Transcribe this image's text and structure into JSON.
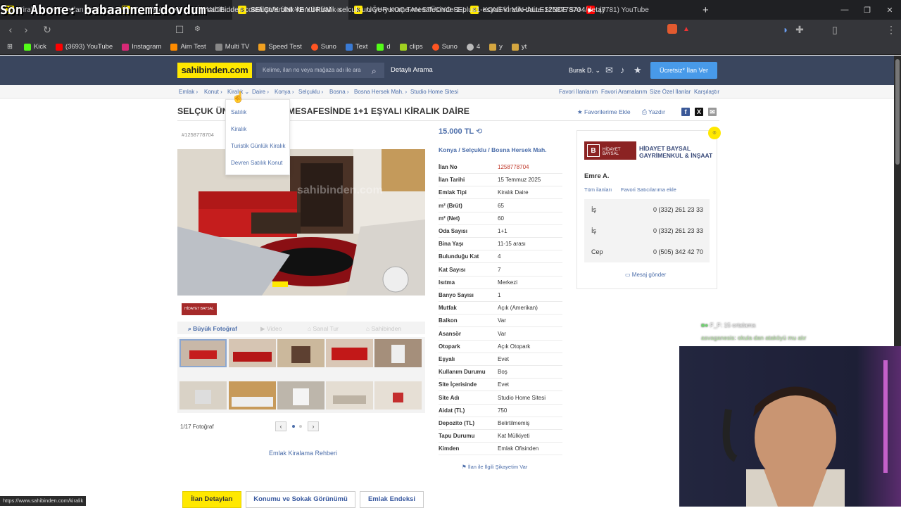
{
  "overlay_text": "Son Abone: babaannemidovdum",
  "browser": {
    "tabs": [
      {
        "label": "Kiralık Daire Fiyatları ve Kiralık Ev İlanları",
        "fav": "S",
        "favclass": "fav-s"
      },
      {
        "label": "TOLUHAN 3+1 REZİDANCE da HE",
        "fav": "S",
        "favclass": "fav-s"
      },
      {
        "label": "SELÇUK ÜNİ YE YÜRÜME MESAF",
        "fav": "S",
        "favclass": "fav-s"
      },
      {
        "label": "UĞUR KOÇ TAN STÜDYO SELÇUKTA",
        "fav": "S",
        "favclass": "fav-s"
      },
      {
        "label": "KONEVİ MAHALLESİ'NDE SAHİBİNDE",
        "fav": "S",
        "favclass": "fav-s"
      },
      {
        "label": "(7781) YouTube",
        "fav": "▶",
        "favclass": "fav-y"
      }
    ],
    "url": "sahibinden.com/ilan/emlak-konut-kiralik-selcuk-uni-ye-yurume-mesafesinde-1-plus1-esyali-kiralik-daire-1258778704/detay",
    "bookmarks": [
      {
        "label": "Kick",
        "color": "#53fc18"
      },
      {
        "label": "(3693) YouTube",
        "color": "#ff0000"
      },
      {
        "label": "Instagram",
        "color": "#d62976"
      },
      {
        "label": "Aim Test",
        "color": "#ff8c00"
      },
      {
        "label": "Multi TV",
        "color": "#888"
      },
      {
        "label": "Speed Test",
        "color": "#f0a020"
      },
      {
        "label": "Suno",
        "color": "#ff5522"
      },
      {
        "label": "Text",
        "color": "#3a7bd5"
      },
      {
        "label": "d",
        "color": "#53fc18"
      },
      {
        "label": "clips",
        "color": "#a0d020"
      },
      {
        "label": "Suno",
        "color": "#ff5522"
      },
      {
        "label": "4",
        "color": "#bbb"
      },
      {
        "label": "y",
        "color": "#d4a640"
      },
      {
        "label": "yt",
        "color": "#d4a640"
      }
    ],
    "status_url": "https://www.sahibinden.com/kiralik"
  },
  "header": {
    "logo": "sahibinden.com",
    "search_placeholder": "Kelime, ilan no veya mağaza adı ile ara",
    "advanced_search": "Detaylı Arama",
    "user": "Burak D.",
    "cta": "Ücretsiz* İlan Ver"
  },
  "breadcrumb": [
    "Emlak",
    "Konut",
    "Kiralık",
    "Daire",
    "Konya",
    "Selçuklu",
    "Bosna",
    "Bosna Hersek Mah.",
    "Studio Home Sitesi"
  ],
  "right_links": [
    "Favori İlanlarım",
    "Favori Aramalarım",
    "Size Özel İlanlar",
    "Karşılaştır"
  ],
  "dropdown": [
    "Satılık",
    "Kiralık",
    "Turistik Günlük Kiralık",
    "Devren Satılık Konut"
  ],
  "listing": {
    "title": "SELÇUK ÜNİ YE YÜRÜME MESAFESİNDE 1+1 EŞYALI KİRALIK DAİRE",
    "add_favorite": "Favorilerime Ekle",
    "print": "Yazdır",
    "listing_id": "#1258778704",
    "price": "15.000 TL",
    "location": [
      "Konya",
      "Selçuklu",
      "Bosna Hersek Mah."
    ],
    "photo_watermark": "sahibinden.com",
    "photo_tabs": [
      "Büyük Fotoğraf",
      "Video",
      "Sanal Tur",
      "Sahibinden"
    ],
    "photo_count": "1/17 Fotoğraf",
    "guide_link": "Emlak Kiralama Rehberi",
    "complaint": "İlan ile İlgili Şikayetim Var",
    "details": [
      {
        "k": "İlan No",
        "v": "1258778704",
        "red": true
      },
      {
        "k": "İlan Tarihi",
        "v": "15 Temmuz 2025"
      },
      {
        "k": "Emlak Tipi",
        "v": "Kiralık Daire"
      },
      {
        "k": "m² (Brüt)",
        "v": "65"
      },
      {
        "k": "m² (Net)",
        "v": "60"
      },
      {
        "k": "Oda Sayısı",
        "v": "1+1"
      },
      {
        "k": "Bina Yaşı",
        "v": "11-15 arası"
      },
      {
        "k": "Bulunduğu Kat",
        "v": "4"
      },
      {
        "k": "Kat Sayısı",
        "v": "7"
      },
      {
        "k": "Isıtma",
        "v": "Merkezi"
      },
      {
        "k": "Banyo Sayısı",
        "v": "1"
      },
      {
        "k": "Mutfak",
        "v": "Açık (Amerikan)"
      },
      {
        "k": "Balkon",
        "v": "Var"
      },
      {
        "k": "Asansör",
        "v": "Var"
      },
      {
        "k": "Otopark",
        "v": "Açık Otopark"
      },
      {
        "k": "Eşyalı",
        "v": "Evet"
      },
      {
        "k": "Kullanım Durumu",
        "v": "Boş"
      },
      {
        "k": "Site İçerisinde",
        "v": "Evet"
      },
      {
        "k": "Site Adı",
        "v": "Studio Home Sitesi"
      },
      {
        "k": "Aidat (TL)",
        "v": "750"
      },
      {
        "k": "Depozito (TL)",
        "v": "Belirtilmemiş"
      },
      {
        "k": "Tapu Durumu",
        "v": "Kat Mülkiyeti"
      },
      {
        "k": "Kimden",
        "v": "Emlak Ofisinden"
      }
    ]
  },
  "seller": {
    "company_line1": "HİDAYET BAYSAL",
    "company_line2": "GAYRİMENKUL & İNŞAAT",
    "logo_text": "HİDAYET BAYSAL",
    "representative": "Emre A.",
    "all_listings": "Tüm ilanları",
    "add_favorite_seller": "Favori Satıcılarıma ekle",
    "phones": [
      {
        "type": "İş",
        "number": "0 (332) 261 23 33"
      },
      {
        "type": "İş",
        "number": "0 (332) 261 23 33"
      },
      {
        "type": "Cep",
        "number": "0 (505) 342 42 70"
      }
    ],
    "message": "Mesaj gönder"
  },
  "bottom_tabs": [
    "İlan Detayları",
    "Konumu ve Sokak Görünümü",
    "Emlak Endeksi"
  ],
  "stream": {
    "chat1": "F_F: 15 ortalama",
    "chat2": "asvaganesis: okula dan ataköyü mu alır"
  },
  "colors": {
    "brand_yellow": "#ffe800",
    "header_bg": "#3a465e",
    "link_blue": "#4c6eaa",
    "cta_blue": "#489ae9"
  }
}
